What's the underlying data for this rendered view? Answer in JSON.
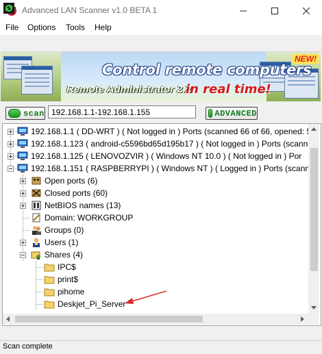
{
  "window": {
    "title": "Advanced LAN Scanner v1.0 BETA 1",
    "controls": [
      "minimize",
      "maximize",
      "close"
    ]
  },
  "menu": [
    "File",
    "Options",
    "Tools",
    "Help"
  ],
  "banner": {
    "headline": "Control remote computers",
    "product": "Remote Administrator 2.2",
    "tagline": "in real time!",
    "badge": "NEW!"
  },
  "scan_bar": {
    "scan_label": "scan",
    "range_value": "192.168.1.1-192.168.1.155",
    "advanced_label": "ADVANCED"
  },
  "tree": {
    "hosts": [
      {
        "text": "192.168.1.1  ( DD-WRT ) ( Not logged in )   Ports (scanned 66 of 66, opened: 5"
      },
      {
        "text": "192.168.1.123  ( android-c5596bd65d195b17 ) ( Not logged in )   Ports (scanne"
      },
      {
        "text": "192.168.1.125  ( LENOVOZVIR      ) ( Windows NT 10.0 ) ( Not logged in )   Por"
      },
      {
        "text": "192.168.1.151  ( RASPBERRYPI ) ( Windows NT ) ( Logged in )   Ports (scanned"
      }
    ],
    "children": [
      {
        "label": "Open ports (6)",
        "icon": "open-ports-icon"
      },
      {
        "label": "Closed ports (60)",
        "icon": "closed-ports-icon"
      },
      {
        "label": "NetBIOS names (13)",
        "icon": "netbios-icon"
      },
      {
        "label": "Domain: WORKGROUP",
        "icon": "domain-icon"
      },
      {
        "label": "Groups (0)",
        "icon": "groups-icon"
      },
      {
        "label": "Users (1)",
        "icon": "users-icon"
      },
      {
        "label": "Shares (4)",
        "icon": "shares-icon"
      }
    ],
    "shares": [
      "IPC$",
      "print$",
      "pihome",
      "Deskjet_Pi_Server"
    ]
  },
  "status": {
    "text": "Scan complete"
  },
  "colors": {
    "accent_green": "#159a1d",
    "arrow_red": "#d92b2b",
    "folder": "#f4d36b"
  }
}
